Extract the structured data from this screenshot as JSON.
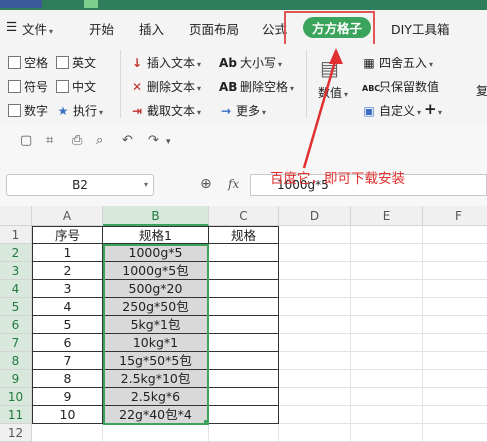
{
  "ribbon_tabs": {
    "file": "文件",
    "home": "开始",
    "insert": "插入",
    "page_layout": "页面布局",
    "formula": "公式",
    "fangfang": "方方格子",
    "diy": "DIY工具箱"
  },
  "ribbon": {
    "cb_space": "空格",
    "cb_english": "英文",
    "cb_symbol": "符号",
    "cb_chinese": "中文",
    "cb_number": "数字",
    "execute": "执行",
    "insert_text": "插入文本",
    "delete_text": "删除文本",
    "extract_text": "截取文本",
    "case": "大小写",
    "delete_space": "删除空格",
    "more": "更多",
    "value": "数值",
    "round": "四舍五入",
    "keep_value": "只保留数值",
    "custom": "自定义",
    "plus": "+",
    "cut_label": "复"
  },
  "formula_bar": {
    "name_box": "B2",
    "fx_label": "fx",
    "content": "1000g*5"
  },
  "annotation": "百度它，即可下载安装",
  "colors": {
    "accent": "#3aa45c",
    "annotation": "#e03030"
  },
  "sheet": {
    "columns": [
      "A",
      "B",
      "C",
      "D",
      "E",
      "F"
    ],
    "rows": [
      "1",
      "2",
      "3",
      "4",
      "5",
      "6",
      "7",
      "8",
      "9",
      "10",
      "11",
      "12"
    ],
    "header": {
      "a": "序号",
      "b": "规格1",
      "c": "规格"
    },
    "data": [
      {
        "a": "1",
        "b": "1000g*5"
      },
      {
        "a": "2",
        "b": "1000g*5包"
      },
      {
        "a": "3",
        "b": "500g*20"
      },
      {
        "a": "4",
        "b": "250g*50包"
      },
      {
        "a": "5",
        "b": "5kg*1包"
      },
      {
        "a": "6",
        "b": "10kg*1"
      },
      {
        "a": "7",
        "b": "15g*50*5包"
      },
      {
        "a": "8",
        "b": "2.5kg*10包"
      },
      {
        "a": "9",
        "b": "2.5kg*6"
      },
      {
        "a": "10",
        "b": "22g*40包*4"
      }
    ]
  }
}
